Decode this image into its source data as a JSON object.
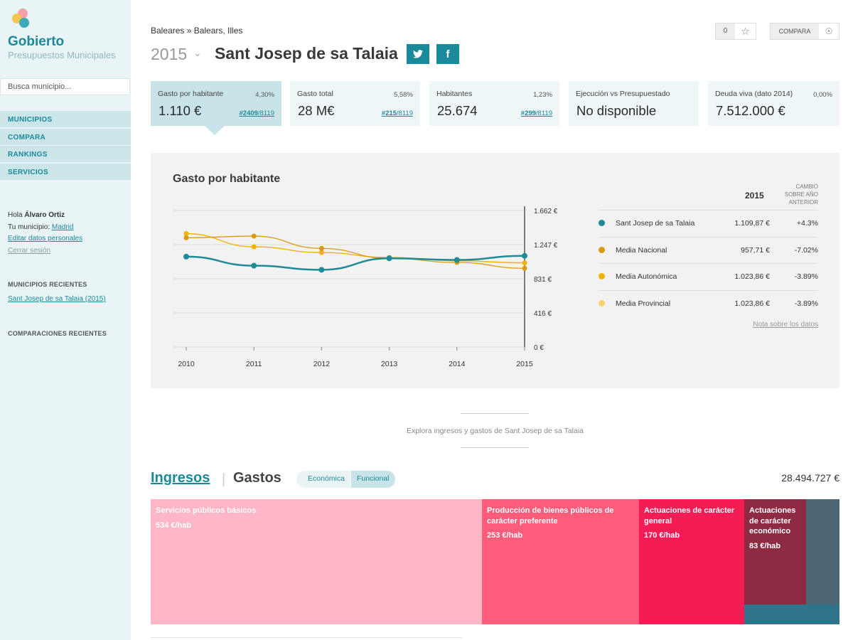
{
  "brand": {
    "name": "Gobierto",
    "subtitle": "Presupuestos Municipales"
  },
  "search": {
    "placeholder": "Busca municipio..."
  },
  "nav": [
    {
      "label": "MUNICIPIOS"
    },
    {
      "label": "COMPARA"
    },
    {
      "label": "RANKINGS"
    },
    {
      "label": "SERVICIOS"
    }
  ],
  "user": {
    "greeting": "Hola",
    "name": "Álvaro Ortiz",
    "municipio_label": "Tu municipio:",
    "municipio": "Madrid",
    "edit_link": "Editar datos personales",
    "logout_link": "Cerrar sesión"
  },
  "recent": {
    "municipios_heading": "MUNICIPIOS RECIENTES",
    "municipios_item": "Sant Josep de sa Talaia (2015)",
    "comparaciones_heading": "COMPARACIONES RECIENTES"
  },
  "header": {
    "breadcrumb": "Baleares » Balears, Illes",
    "year": "2015",
    "title": "Sant Josep de sa Talaia",
    "fav_count": "0",
    "compare_label": "COMPARA"
  },
  "kpis": [
    {
      "label": "Gasto por habitante",
      "pct": "4,30%",
      "value": "1.110 €",
      "rank": "#2409",
      "rank_total": "/8119"
    },
    {
      "label": "Gasto total",
      "pct": "5,58%",
      "value": "28 M€",
      "rank": "#215",
      "rank_total": "/8119"
    },
    {
      "label": "Habitantes",
      "pct": "1,23%",
      "value": "25.674",
      "rank": "#299",
      "rank_total": "/8119"
    },
    {
      "label": "Ejecución vs Presupuestado",
      "pct": "",
      "value": "No disponible",
      "rank": "",
      "rank_total": ""
    },
    {
      "label": "Deuda viva (dato 2014)",
      "pct": "0,00%",
      "value": "7.512.000 €",
      "rank": "",
      "rank_total": ""
    }
  ],
  "chart_data": {
    "type": "line",
    "title": "Gasto por habitante",
    "x": [
      2010,
      2011,
      2012,
      2013,
      2014,
      2015
    ],
    "y_ticks": [
      "1.662 €",
      "1.247 €",
      "831 €",
      "416 €",
      "0 €"
    ],
    "ylim": [
      0,
      1662
    ],
    "y_axis_side": "right",
    "series": [
      {
        "name": "Sant Josep de sa Talaia",
        "color": "#1f8a98",
        "values": [
          1100,
          990,
          940,
          1080,
          1060,
          1110
        ]
      },
      {
        "name": "Media Nacional",
        "color": "#d99a12",
        "values": [
          1330,
          1350,
          1200,
          1080,
          1030,
          958
        ]
      },
      {
        "name": "Media Autonómica",
        "color": "#f0b400",
        "values": [
          1380,
          1220,
          1150,
          1090,
          1050,
          1024
        ]
      },
      {
        "name": "Media Provincial",
        "color": "#f5d26a",
        "values": [
          1380,
          1220,
          1150,
          1090,
          1050,
          1024
        ]
      }
    ]
  },
  "legend_table": {
    "year_header": "2015",
    "change_header": "CAMBIO SOBRE AÑO ANTERIOR",
    "rows": [
      {
        "name": "Sant Josep de sa Talaia",
        "color": "#1f8a98",
        "value": "1.109,87 €",
        "change": "+4.3%"
      },
      {
        "name": "Media Nacional",
        "color": "#d99a12",
        "value": "957,71 €",
        "change": "-7.02%"
      },
      {
        "name": "Media Autonómica",
        "color": "#f0b400",
        "value": "1.023,86 €",
        "change": "-3.89%"
      },
      {
        "name": "Media Provincial",
        "color": "#f5d26a",
        "value": "1.023,86 €",
        "change": "-3.89%"
      }
    ],
    "note_link": "Nota sobre los datos"
  },
  "explore": {
    "text": "Explora ingresos y gastos de Sant Josep de sa Talaia"
  },
  "tabs": {
    "ingresos": "Ingresos",
    "separator": "|",
    "gastos": "Gastos",
    "economica": "Económica",
    "funcional": "Funcional",
    "total": "28.494.727 €"
  },
  "treemap": [
    {
      "title": "Servicios públicos básicos",
      "value": "534 €/hab",
      "color": "#ffb6c6"
    },
    {
      "title": "Producción de bienes públicos de carácter preferente",
      "value": "253 €/hab",
      "color": "#fd5c7a"
    },
    {
      "title": "Actuaciones de carácter general",
      "value": "170 €/hab",
      "color": "#f41c55"
    },
    {
      "title": "Actuaciones de carácter económico",
      "value": "83 €/hab",
      "color": "#8e2a41"
    },
    {
      "title": "",
      "value": "",
      "color": "#4d6676"
    },
    {
      "title": "",
      "value": "",
      "color": "#2f748b"
    }
  ]
}
